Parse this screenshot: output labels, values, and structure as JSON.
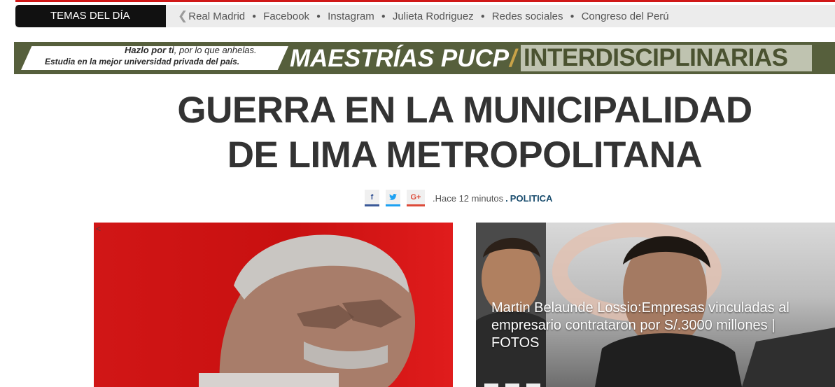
{
  "temas": {
    "label": "TEMAS DEL DÍA",
    "prev_icon": "chevron-left-icon",
    "items": [
      "Real Madrid",
      "Facebook",
      "Instagram",
      "Julieta Rodriguez",
      "Redes sociales",
      "Congreso del Perú"
    ],
    "separator": "●"
  },
  "banner": {
    "line1_bold": "Hazlo por ti",
    "line1_rest": ", por lo que anhelas.",
    "line2": "Estudia en la mejor universidad privada del país.",
    "big1": "MAESTRÍAS PUCP",
    "slash": "/",
    "big2": "INTERDISCIPLINARIAS"
  },
  "article": {
    "headline_line1": "GUERRA EN LA MUNICIPALIDAD",
    "headline_line2": "DE LIMA METROPOLITANA",
    "share": {
      "facebook": "f",
      "twitter": "t",
      "googleplus": "G+"
    },
    "time": ".Hace 12 minutos",
    "dot": ".",
    "category": "POLITICA"
  },
  "left_image": {
    "arrow": "<"
  },
  "right_card": {
    "caption": "Martin Belaunde Lossio:Empresas vinculadas al empresario contrataron por S/.3000 millones | FOTOS"
  },
  "colors": {
    "accent_red": "#d01818",
    "category_blue": "#1a4d6e",
    "facebook": "#3b5998",
    "twitter": "#1da1f2",
    "googleplus": "#dd4b39"
  }
}
